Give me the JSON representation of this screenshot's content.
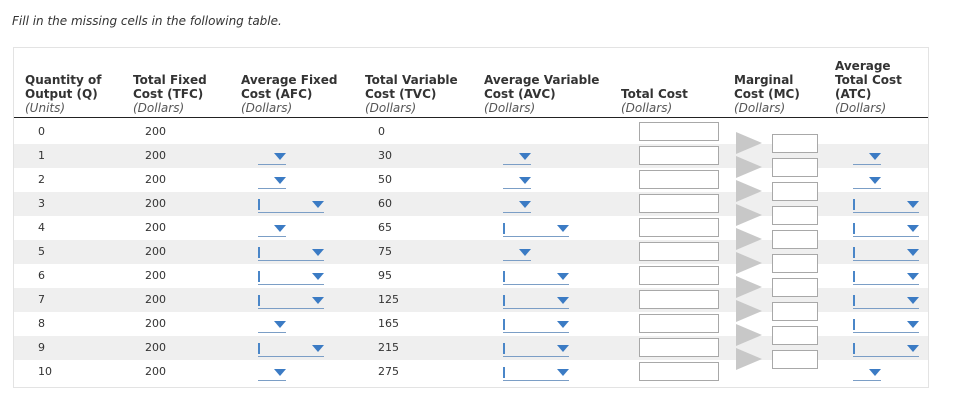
{
  "instruction": "Fill in the missing cells in the following table.",
  "headers": {
    "q": {
      "l1": "Quantity of",
      "l2": "Output (Q)",
      "unit": "(Units)"
    },
    "tfc": {
      "l1": "Total Fixed",
      "l2": "Cost (TFC)",
      "unit": "(Dollars)"
    },
    "afc": {
      "l1": "Average Fixed",
      "l2": "Cost (AFC)",
      "unit": "(Dollars)"
    },
    "tvc": {
      "l1": "Total Variable",
      "l2": "Cost (TVC)",
      "unit": "(Dollars)"
    },
    "avc": {
      "l1": "Average Variable",
      "l2": "Cost (AVC)",
      "unit": "(Dollars)"
    },
    "tc": {
      "l1": "",
      "l2": "Total Cost",
      "unit": "(Dollars)"
    },
    "mc": {
      "l1": "Marginal",
      "l2": "Cost (MC)",
      "unit": "(Dollars)"
    },
    "atc": {
      "l0": "Average",
      "l1": "Total Cost",
      "l2": "(ATC)",
      "unit": "(Dollars)"
    }
  },
  "rows": [
    {
      "q": "0",
      "tfc": "200",
      "tvc": "0"
    },
    {
      "q": "1",
      "tfc": "200",
      "tvc": "30"
    },
    {
      "q": "2",
      "tfc": "200",
      "tvc": "50"
    },
    {
      "q": "3",
      "tfc": "200",
      "tvc": "60"
    },
    {
      "q": "4",
      "tfc": "200",
      "tvc": "65"
    },
    {
      "q": "5",
      "tfc": "200",
      "tvc": "75"
    },
    {
      "q": "6",
      "tfc": "200",
      "tvc": "95"
    },
    {
      "q": "7",
      "tfc": "200",
      "tvc": "125"
    },
    {
      "q": "8",
      "tfc": "200",
      "tvc": "165"
    },
    {
      "q": "9",
      "tfc": "200",
      "tvc": "215"
    },
    {
      "q": "10",
      "tfc": "200",
      "tvc": "275"
    }
  ],
  "afc_dropdown_style": [
    "none",
    "short",
    "short",
    "long",
    "short",
    "long",
    "long",
    "long",
    "short",
    "long",
    "short"
  ],
  "avc_dropdown_style": [
    "none",
    "short",
    "short",
    "short",
    "long",
    "short",
    "long",
    "long",
    "long",
    "long",
    "long"
  ],
  "atc_dropdown_style": [
    "none",
    "short",
    "short",
    "long",
    "long",
    "long",
    "long",
    "long",
    "long",
    "long",
    "short"
  ],
  "colors": {
    "accent": "#3b7bc4",
    "shade": "#efefef",
    "chevron": "#c8c8c8"
  }
}
